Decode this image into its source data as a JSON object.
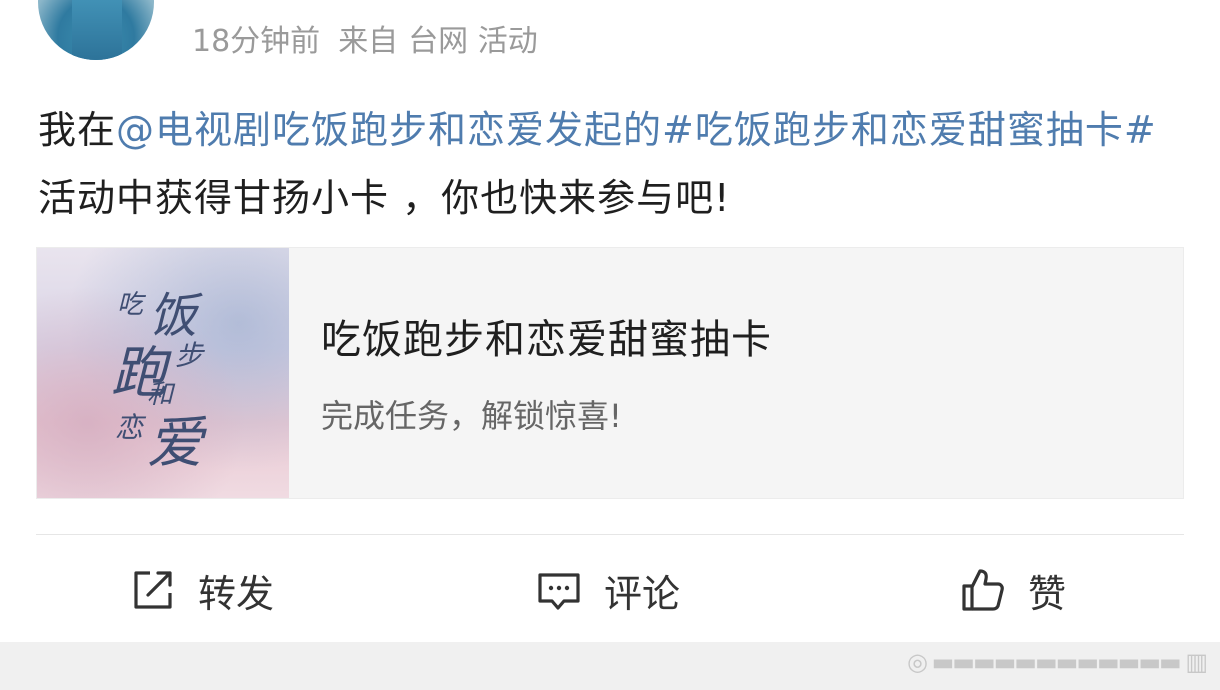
{
  "header": {
    "time": "18分钟前",
    "source_label": "来自",
    "source": "台网 活动"
  },
  "content": {
    "prefix": "我在",
    "mention": "@电视剧吃饭跑步和恋爱",
    "middle": "发起的",
    "hashtag": "#吃饭跑步和恋爱甜蜜抽卡#",
    "suffix": "活动中获得甘扬小卡 ，你也快来参与吧!"
  },
  "card": {
    "thumb_text": [
      "吃",
      "饭",
      "跑",
      "步",
      "和",
      "恋",
      "爱"
    ],
    "title": "吃饭跑步和恋爱甜蜜抽卡",
    "subtitle": "完成任务，解锁惊喜!"
  },
  "actions": {
    "repost_label": "转发",
    "comment_label": "评论",
    "like_label": "赞"
  },
  "icons": {
    "repost": "share-edit-icon",
    "comment": "comment-bubble-icon",
    "like": "thumbs-up-icon"
  },
  "colors": {
    "link": "#4f7cae",
    "meta": "#9a9a9a",
    "text": "#1f1f1f"
  }
}
